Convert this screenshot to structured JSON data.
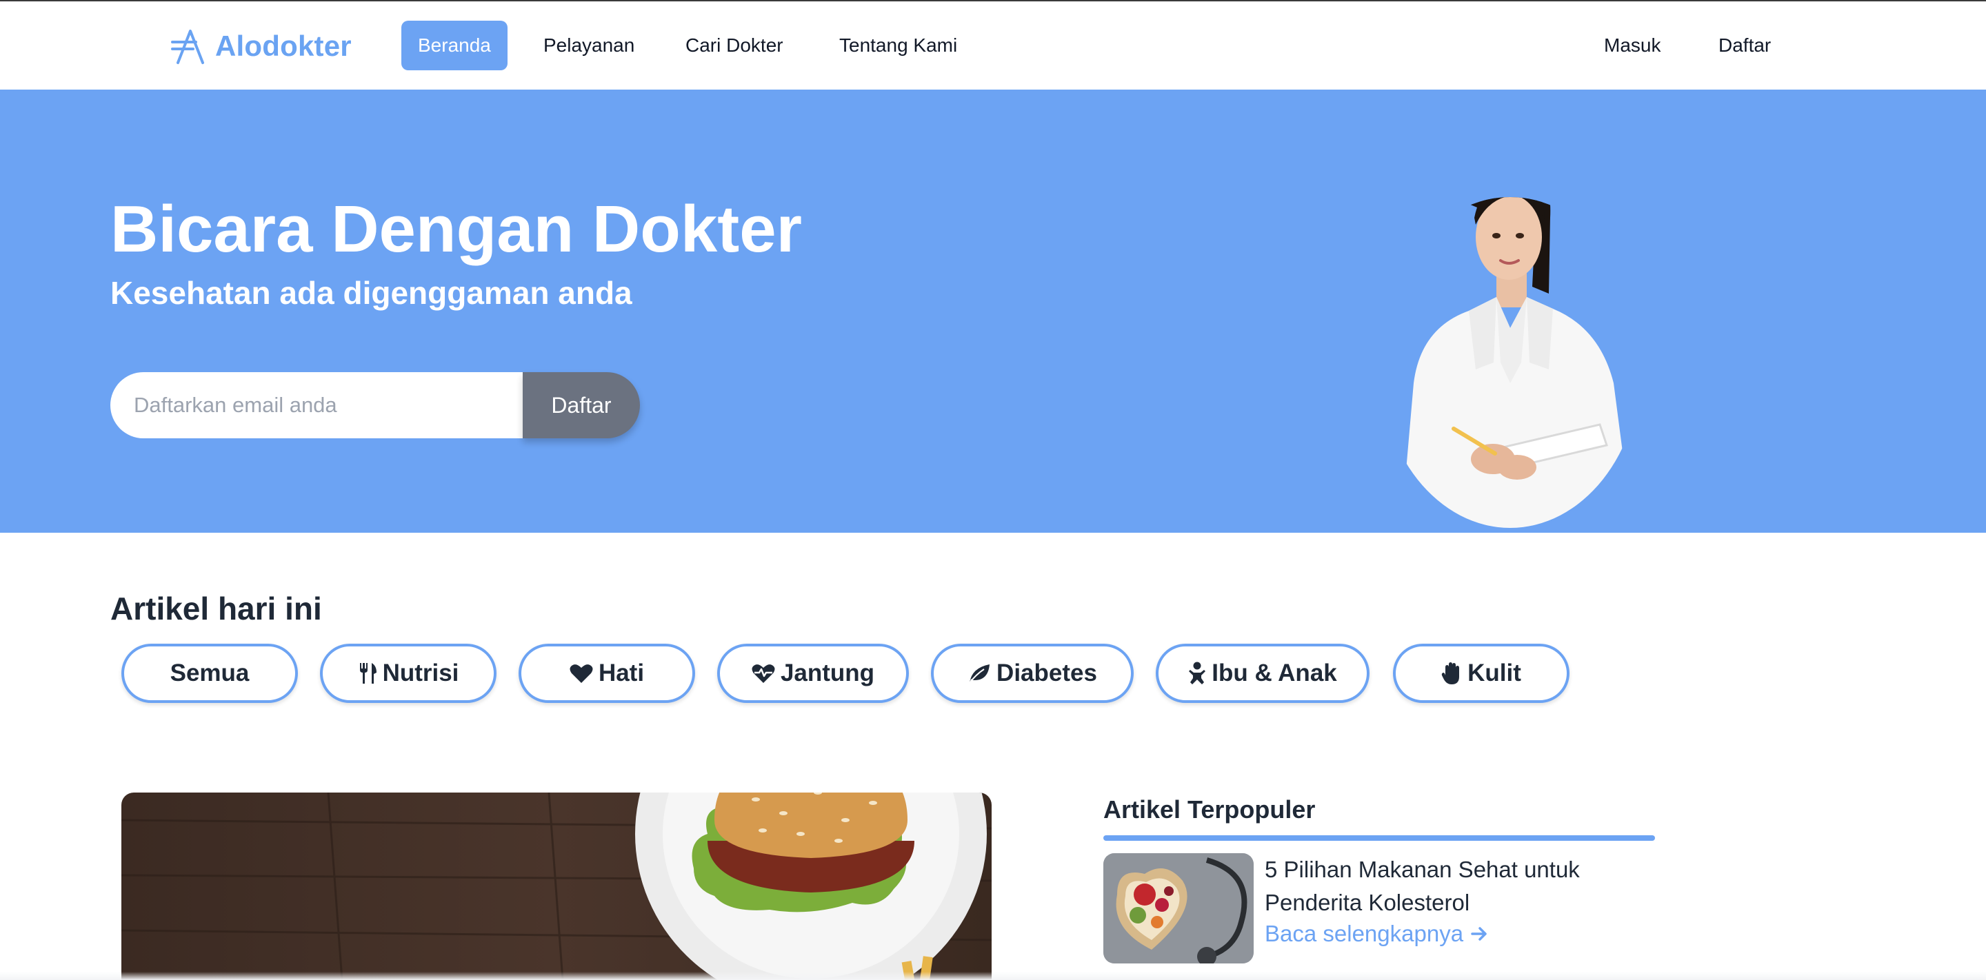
{
  "brand": {
    "name": "Alodokter",
    "color": "#6aa3f2"
  },
  "nav": {
    "items": [
      {
        "label": "Beranda",
        "active": true
      },
      {
        "label": "Pelayanan",
        "active": false
      },
      {
        "label": "Cari Dokter",
        "active": false
      },
      {
        "label": "Tentang Kami",
        "active": false
      }
    ],
    "login_label": "Masuk",
    "register_label": "Daftar"
  },
  "hero": {
    "title": "Bicara Dengan Dokter",
    "subtitle": "Kesehatan ada digenggaman anda",
    "email_placeholder": "Daftarkan email anda",
    "email_value": "",
    "submit_label": "Daftar",
    "background": "#6ca3f3"
  },
  "articles": {
    "title": "Artikel hari ini",
    "categories": [
      {
        "label": "Semua",
        "icon": ""
      },
      {
        "label": "Nutrisi",
        "icon": "utensils-icon"
      },
      {
        "label": "Hati",
        "icon": "heart-icon"
      },
      {
        "label": "Jantung",
        "icon": "heartbeat-icon"
      },
      {
        "label": "Diabetes",
        "icon": "leaf-icon"
      },
      {
        "label": "Ibu & Anak",
        "icon": "baby-icon"
      },
      {
        "label": "Kulit",
        "icon": "hand-icon"
      }
    ]
  },
  "popular": {
    "title": "Artikel Terpopuler",
    "items": [
      {
        "title": "5 Pilihan Makanan Sehat untuk Penderita Kolesterol",
        "read_more": "Baca selengkapnya"
      }
    ]
  }
}
